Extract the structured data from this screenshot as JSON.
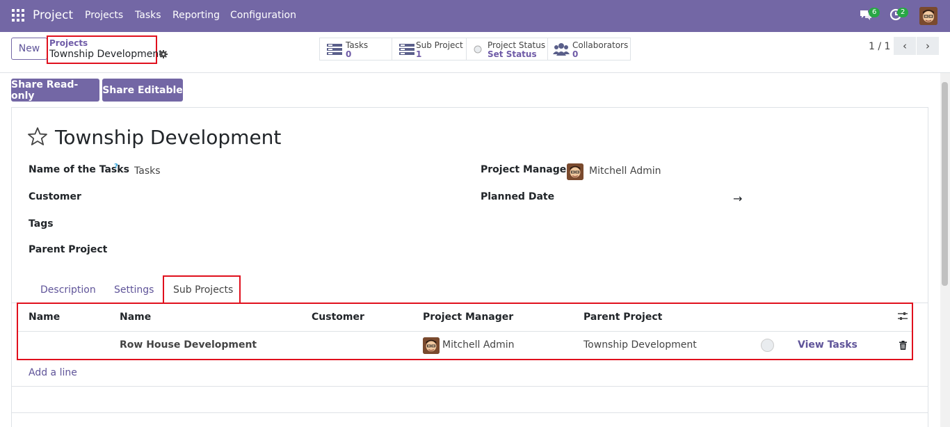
{
  "navbar": {
    "app_name": "Project",
    "menu": [
      "Projects",
      "Tasks",
      "Reporting",
      "Configuration"
    ],
    "messages_count": "6",
    "activities_count": "2"
  },
  "control_panel": {
    "new_label": "New",
    "breadcrumb_parent": "Projects",
    "breadcrumb_current": "Township Development",
    "smart_buttons": [
      {
        "label": "Tasks",
        "value": "0",
        "icon": "tasks-icon"
      },
      {
        "label": "Sub Project",
        "value": "1",
        "icon": "tasks-icon"
      },
      {
        "label": "Project Status",
        "value": "Set Status",
        "icon": "status-circle-icon"
      },
      {
        "label": "Collaborators",
        "value": "0",
        "icon": "users-icon"
      }
    ],
    "pager": "1 / 1"
  },
  "actions": {
    "share_readonly": "Share Read-only",
    "share_editable": "Share Editable"
  },
  "form": {
    "title": "Township Development",
    "fields": {
      "name_of_tasks_label": "Name of the Tasks",
      "name_of_tasks_help": "?",
      "name_of_tasks_value": "Tasks",
      "customer_label": "Customer",
      "tags_label": "Tags",
      "parent_project_label": "Parent Project",
      "project_manager_label": "Project Manager",
      "project_manager_value": "Mitchell Admin",
      "planned_date_label": "Planned Date",
      "planned_date_arrow": "→"
    },
    "tabs": [
      "Description",
      "Settings",
      "Sub Projects"
    ],
    "active_tab": "Sub Projects"
  },
  "sub_projects_table": {
    "headers": [
      "Name",
      "Name",
      "Customer",
      "Project Manager",
      "Parent Project"
    ],
    "rows": [
      {
        "name": "",
        "name2": "Row House Development",
        "customer": "",
        "project_manager": "Mitchell Admin",
        "parent_project": "Township Development",
        "action": "View Tasks"
      }
    ],
    "add_line": "Add a line"
  },
  "colors": {
    "navbar": "#7367a5",
    "accent": "#5f5499",
    "highlight": "#e0101d",
    "badge": "#28a745"
  }
}
